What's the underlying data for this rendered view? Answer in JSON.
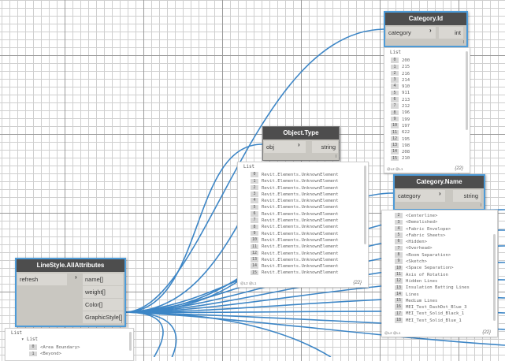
{
  "nodes": {
    "category_id": {
      "title": "Category.Id",
      "input": "category",
      "output": "int",
      "lacing": "l"
    },
    "object_type": {
      "title": "Object.Type",
      "input": "obj",
      "output": "string",
      "lacing": "l"
    },
    "category_name": {
      "title": "Category.Name",
      "input": "category",
      "output": "string",
      "lacing": "l"
    },
    "linestyle": {
      "title": "LineStyle.AllAttributes",
      "input": "refresh",
      "outputs": [
        "name[]",
        "weight[]",
        "Color[]",
        "GraphicStyle[]"
      ],
      "lacing": "l"
    }
  },
  "previews": {
    "category_id": {
      "header": "List",
      "rows": [
        {
          "i": "0",
          "v": "200"
        },
        {
          "i": "1",
          "v": "215"
        },
        {
          "i": "2",
          "v": "216"
        },
        {
          "i": "3",
          "v": "214"
        },
        {
          "i": "4",
          "v": "910"
        },
        {
          "i": "5",
          "v": "911"
        },
        {
          "i": "6",
          "v": "213"
        },
        {
          "i": "7",
          "v": "212"
        },
        {
          "i": "8",
          "v": "196"
        },
        {
          "i": "9",
          "v": "199"
        },
        {
          "i": "10",
          "v": "197"
        },
        {
          "i": "11",
          "v": "622"
        },
        {
          "i": "12",
          "v": "195"
        },
        {
          "i": "13",
          "v": "198"
        },
        {
          "i": "14",
          "v": "208"
        },
        {
          "i": "15",
          "v": "210"
        }
      ],
      "footer": "@L2 @L1",
      "count": "{22}"
    },
    "object_type": {
      "header": "List",
      "rows": [
        {
          "i": "0",
          "v": "Revit.Elements.UnknownElement"
        },
        {
          "i": "1",
          "v": "Revit.Elements.UnknownElement"
        },
        {
          "i": "2",
          "v": "Revit.Elements.UnknownElement"
        },
        {
          "i": "3",
          "v": "Revit.Elements.UnknownElement"
        },
        {
          "i": "4",
          "v": "Revit.Elements.UnknownElement"
        },
        {
          "i": "5",
          "v": "Revit.Elements.UnknownElement"
        },
        {
          "i": "6",
          "v": "Revit.Elements.UnknownElement"
        },
        {
          "i": "7",
          "v": "Revit.Elements.UnknownElement"
        },
        {
          "i": "8",
          "v": "Revit.Elements.UnknownElement"
        },
        {
          "i": "9",
          "v": "Revit.Elements.UnknownElement"
        },
        {
          "i": "10",
          "v": "Revit.Elements.UnknownElement"
        },
        {
          "i": "11",
          "v": "Revit.Elements.UnknownElement"
        },
        {
          "i": "12",
          "v": "Revit.Elements.UnknownElement"
        },
        {
          "i": "13",
          "v": "Revit.Elements.UnknownElement"
        },
        {
          "i": "14",
          "v": "Revit.Elements.UnknownElement"
        },
        {
          "i": "15",
          "v": "Revit.Elements.UnknownElement"
        }
      ],
      "footer": "@L2 @L1",
      "count": "{22}"
    },
    "category_name": {
      "rows": [
        {
          "i": "2",
          "v": "<Centerline>"
        },
        {
          "i": "3",
          "v": "<Demolished>"
        },
        {
          "i": "4",
          "v": "<Fabric Envelope>"
        },
        {
          "i": "5",
          "v": "<Fabric Sheets>"
        },
        {
          "i": "6",
          "v": "<Hidden>"
        },
        {
          "i": "7",
          "v": "<Overhead>"
        },
        {
          "i": "8",
          "v": "<Room Separation>"
        },
        {
          "i": "9",
          "v": "<Sketch>"
        },
        {
          "i": "10",
          "v": "<Space Separation>"
        },
        {
          "i": "11",
          "v": "Axis of Rotation"
        },
        {
          "i": "12",
          "v": "Hidden Lines"
        },
        {
          "i": "13",
          "v": "Insulation Batting Lines"
        },
        {
          "i": "14",
          "v": "Lines"
        },
        {
          "i": "15",
          "v": "Medium Lines"
        },
        {
          "i": "16",
          "v": "MEI_Test_DashDot_Blue_3"
        },
        {
          "i": "17",
          "v": "MEI_Test_Solid_Black_1"
        },
        {
          "i": "18",
          "v": "MEI_Test_Solid_Blue_1"
        }
      ],
      "footer": "@L2 @L1",
      "count": "{22}"
    },
    "linestyle": {
      "header": "List",
      "tree_label": "List",
      "rows": [
        {
          "i": "0",
          "v": "<Area Boundary>"
        },
        {
          "i": "1",
          "v": "<Beyond>"
        }
      ]
    }
  },
  "colors": {
    "wire": "#3d86c6",
    "title_bar": "#4d4d4d",
    "node_body": "#c9c7c1",
    "selected_border": "#4d9bd8"
  }
}
